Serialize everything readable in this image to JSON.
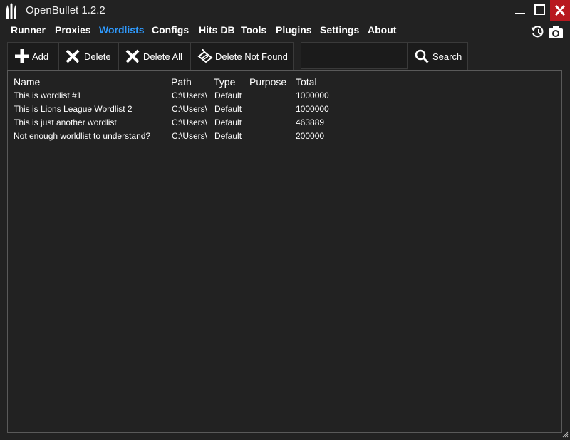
{
  "app": {
    "title": "OpenBullet 1.2.2"
  },
  "menu": [
    {
      "label": "Runner",
      "active": false
    },
    {
      "label": "Proxies",
      "active": false
    },
    {
      "label": "Wordlists",
      "active": true
    },
    {
      "label": "Configs",
      "active": false
    },
    {
      "label": "Hits DB",
      "active": false
    },
    {
      "label": "Tools",
      "active": false
    },
    {
      "label": "Plugins",
      "active": false
    },
    {
      "label": "Settings",
      "active": false
    },
    {
      "label": "About",
      "active": false
    }
  ],
  "toolbar": {
    "add_label": "Add",
    "delete_label": "Delete",
    "delete_all_label": "Delete All",
    "delete_not_found_label": "Delete Not Found",
    "search_value": "",
    "search_label": "Search"
  },
  "table": {
    "columns": [
      "Name",
      "Path",
      "Type",
      "Purpose",
      "Total"
    ],
    "rows": [
      {
        "name": "This is wordlist #1",
        "path": "C:\\Users\\",
        "type": "Default",
        "purpose": "",
        "total": "1000000"
      },
      {
        "name": "This is Lions League Wordlist 2",
        "path": "C:\\Users\\",
        "type": "Default",
        "purpose": "",
        "total": "1000000"
      },
      {
        "name": "This is just another wordlist",
        "path": "C:\\Users\\",
        "type": "Default",
        "purpose": "",
        "total": "463889"
      },
      {
        "name": "Not enough worldlist to understand?",
        "path": "C:\\Users\\",
        "type": "Default",
        "purpose": "",
        "total": "200000"
      }
    ]
  },
  "colors": {
    "background": "#222222",
    "accent": "#2f9bff",
    "close": "#b8191f"
  },
  "icons": [
    "openbullet-logo-icon",
    "minimize-icon",
    "maximize-icon",
    "close-icon",
    "reload-icon",
    "camera-icon",
    "plus-icon",
    "x-icon",
    "broom-icon",
    "search-icon",
    "resize-grip-icon"
  ]
}
